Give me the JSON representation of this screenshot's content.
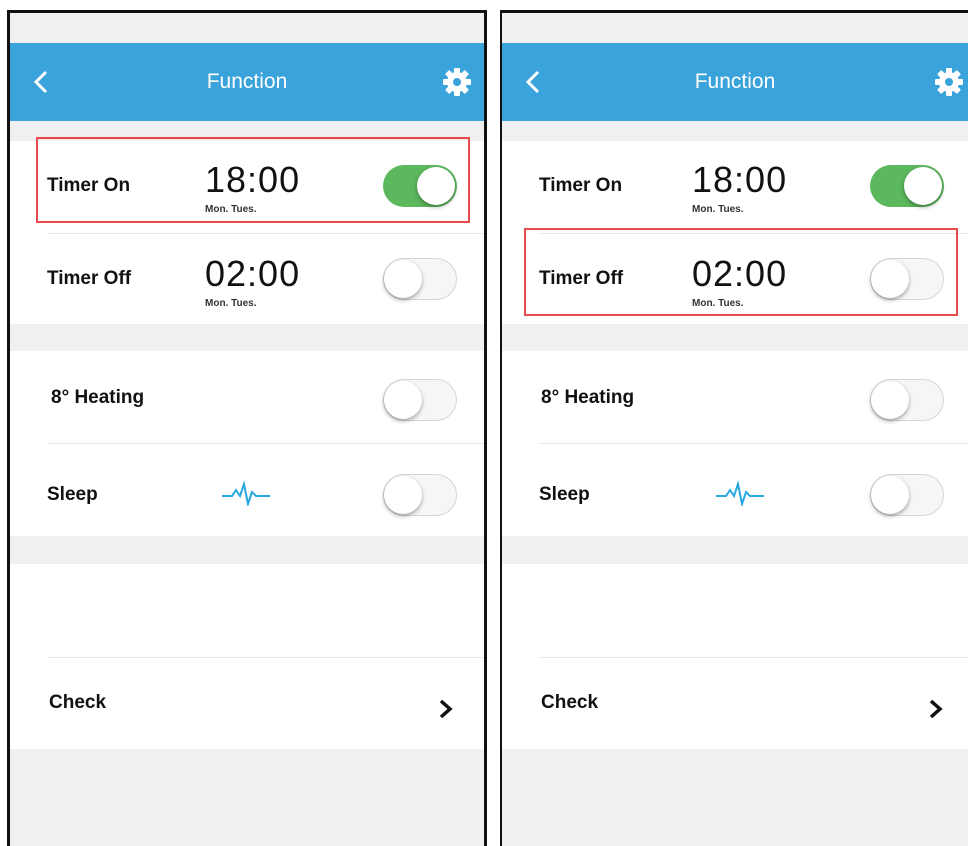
{
  "panels": [
    {
      "header": {
        "title": "Function",
        "back_icon": "chevron-left-icon",
        "settings_icon": "gear-icon"
      },
      "timers": [
        {
          "label": "Timer On",
          "time": "18:00",
          "days": "Mon. Tues.",
          "enabled": true
        },
        {
          "label": "Timer Off",
          "time": "02:00",
          "days": "Mon. Tues.",
          "enabled": false
        }
      ],
      "features": [
        {
          "label": "8° Heating",
          "enabled": false
        },
        {
          "label": "Sleep",
          "icon": "pulse-icon",
          "enabled": false
        }
      ],
      "check": {
        "label": "Check",
        "icon": "chevron-right-icon"
      },
      "highlighted": "Timer On"
    },
    {
      "header": {
        "title": "Function",
        "back_icon": "chevron-left-icon",
        "settings_icon": "gear-icon"
      },
      "timers": [
        {
          "label": "Timer On",
          "time": "18:00",
          "days": "Mon. Tues.",
          "enabled": true
        },
        {
          "label": "Timer Off",
          "time": "02:00",
          "days": "Mon. Tues.",
          "enabled": false
        }
      ],
      "features": [
        {
          "label": "8° Heating",
          "enabled": false
        },
        {
          "label": "Sleep",
          "icon": "pulse-icon",
          "enabled": false
        }
      ],
      "check": {
        "label": "Check",
        "icon": "chevron-right-icon"
      },
      "highlighted": "Timer Off"
    }
  ],
  "colors": {
    "header": "#3ba3db",
    "toggle_on": "#5cb85c",
    "highlight_border": "#e74c4c",
    "pulse": "#29a8e0"
  }
}
